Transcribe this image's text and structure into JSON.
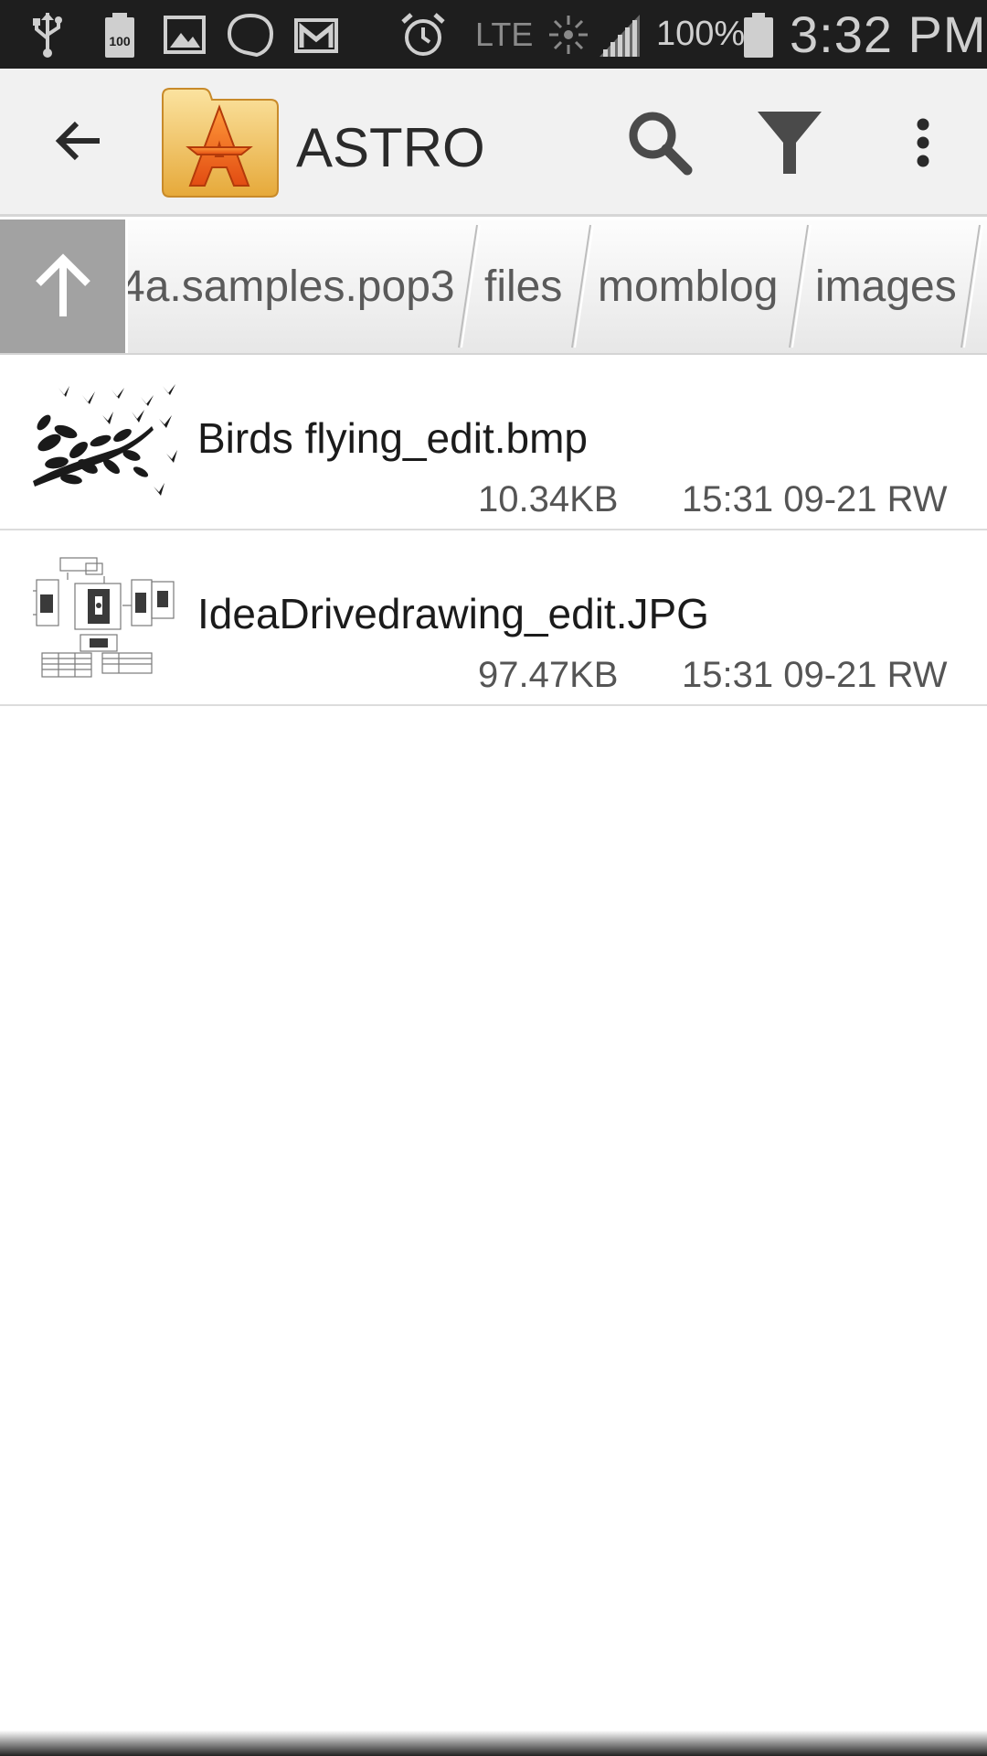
{
  "status_bar": {
    "icons": [
      "usb-icon",
      "battery-100-icon",
      "gallery-icon",
      "chat-bubble-icon",
      "gmail-icon",
      "alarm-icon",
      "signal-activity-icon",
      "cell-signal-icon",
      "battery-icon"
    ],
    "battery_badge": "100",
    "network": "LTE",
    "battery_percent": "100%",
    "time": "3:32 PM"
  },
  "action_bar": {
    "title": "ASTRO",
    "logo_letter": "A",
    "icons": [
      "back-arrow-icon",
      "astro-folder-logo",
      "search-icon",
      "filter-icon",
      "more-vert-icon"
    ]
  },
  "breadcrumb": {
    "up_icon": "arrow-up-icon",
    "segments": [
      "4a.samples.pop3",
      "files",
      "momblog",
      "images"
    ]
  },
  "files": [
    {
      "name": "Birds flying_edit.bmp",
      "size": "10.34KB",
      "meta": "15:31 09-21 RW",
      "thumb_icon": "birds-thumbnail"
    },
    {
      "name": "IdeaDrivedrawing_edit.JPG",
      "size": "97.47KB",
      "meta": "15:31 09-21 RW",
      "thumb_icon": "drawing-thumbnail"
    }
  ],
  "colors": {
    "status_bar_bg": "#1e1e1e",
    "action_bar_bg": "#f1f1f1",
    "up_button_bg": "#a2a2a2",
    "logo_folder": "#f2c24a",
    "logo_star": "#f26a1b"
  }
}
